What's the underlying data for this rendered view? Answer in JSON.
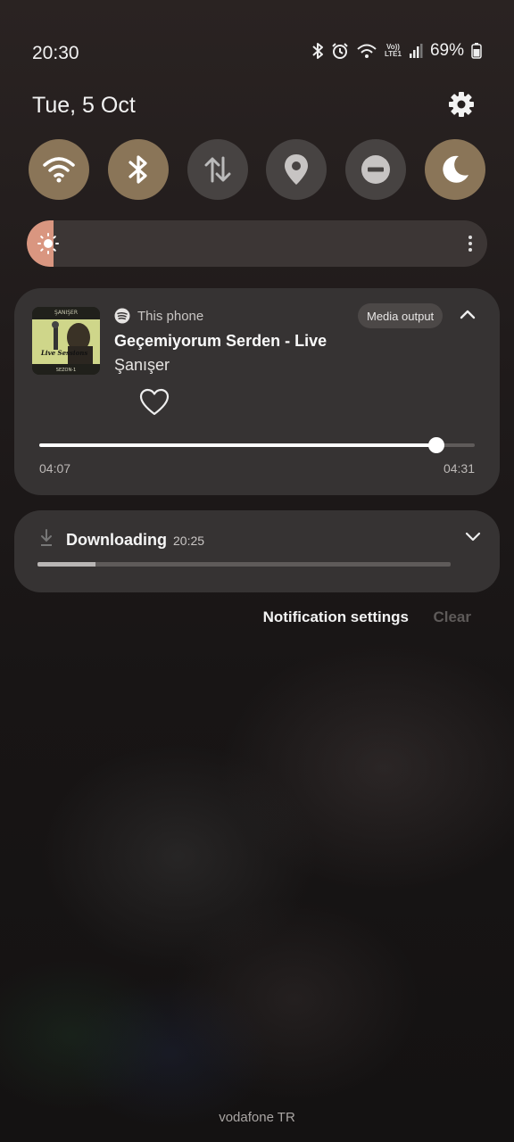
{
  "status_bar": {
    "time": "20:30",
    "battery": "69%",
    "network_top": "Vo))",
    "network_bottom": "LTE1"
  },
  "header": {
    "date": "Tue, 5 Oct"
  },
  "quick_settings": [
    {
      "name": "Wi-Fi",
      "icon": "wifi-icon",
      "on": true
    },
    {
      "name": "Bluetooth",
      "icon": "bluetooth-icon",
      "on": true
    },
    {
      "name": "Mobile data",
      "icon": "mobile-data-icon",
      "on": false
    },
    {
      "name": "Location",
      "icon": "location-icon",
      "on": false
    },
    {
      "name": "Do not disturb",
      "icon": "do-not-disturb-icon",
      "on": false
    },
    {
      "name": "Dark mode",
      "icon": "moon-icon",
      "on": true
    }
  ],
  "brightness": {
    "level_fraction": 0.06
  },
  "media": {
    "source": "This phone",
    "output_button": "Media output",
    "title": "Geçemiyorum Serden - Live",
    "artist": "Şanışer",
    "album_art_text_top": "ŞANIŞER",
    "album_art_text_main": "Live Sessions",
    "album_art_text_bottom": "SEZON-1",
    "elapsed": "04:07",
    "duration": "04:31",
    "progress_fraction": 0.911
  },
  "download": {
    "title": "Downloading",
    "time": "20:25",
    "progress_fraction": 0.14
  },
  "actions": {
    "notification_settings": "Notification settings",
    "clear": "Clear"
  },
  "footer": {
    "carrier": "vodafone TR"
  },
  "colors": {
    "toggle_on": "#8a7558",
    "toggle_off": "#474342",
    "card_bg": "#363333",
    "brightness_fill": "#d99680"
  }
}
